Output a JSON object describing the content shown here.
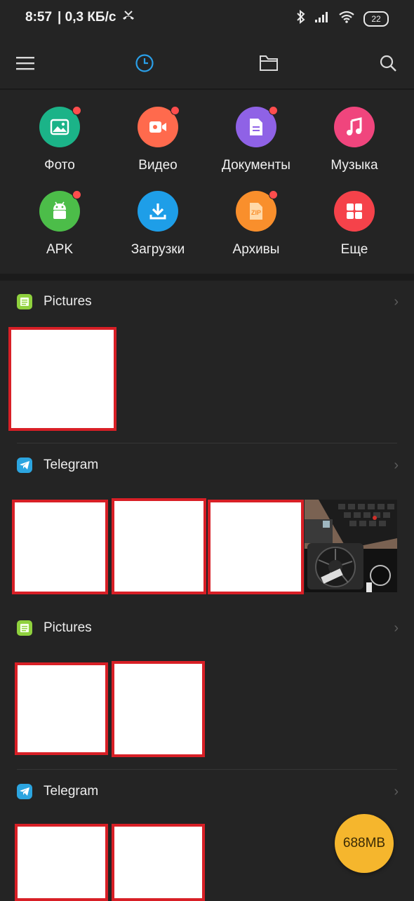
{
  "status": {
    "time": "8:57",
    "speed": "| 0,3 КБ/с",
    "battery": "22"
  },
  "toolbar": {
    "menu_icon": "menu-icon",
    "recent_icon": "clock-icon",
    "folder_icon": "folder-icon",
    "search_icon": "search-icon"
  },
  "categories": [
    {
      "label": "Фото",
      "color": "#1bb388",
      "icon": "image-icon",
      "badge": true
    },
    {
      "label": "Видео",
      "color": "#ff6a4d",
      "icon": "video-icon",
      "badge": true
    },
    {
      "label": "Документы",
      "color": "#8f62e6",
      "icon": "document-icon",
      "badge": true
    },
    {
      "label": "Музыка",
      "color": "#f0457d",
      "icon": "music-icon",
      "badge": false
    },
    {
      "label": "APK",
      "color": "#4cbd49",
      "icon": "android-icon",
      "badge": true
    },
    {
      "label": "Загрузки",
      "color": "#1e9ee8",
      "icon": "download-icon",
      "badge": false
    },
    {
      "label": "Архивы",
      "color": "#f98f2c",
      "icon": "zip-icon",
      "badge": true
    },
    {
      "label": "Еще",
      "color": "#f5424a",
      "icon": "grid-icon",
      "badge": false
    }
  ],
  "groups": [
    {
      "title": "Pictures",
      "icon": "notes-icon",
      "icon_color": "#8fd13e"
    },
    {
      "title": "Telegram",
      "icon": "telegram-icon",
      "icon_color": "#2ca5e0"
    },
    {
      "title": "Pictures",
      "icon": "notes-icon",
      "icon_color": "#8fd13e"
    },
    {
      "title": "Telegram",
      "icon": "telegram-icon",
      "icon_color": "#2ca5e0"
    }
  ],
  "fab": {
    "label": "688MB"
  }
}
